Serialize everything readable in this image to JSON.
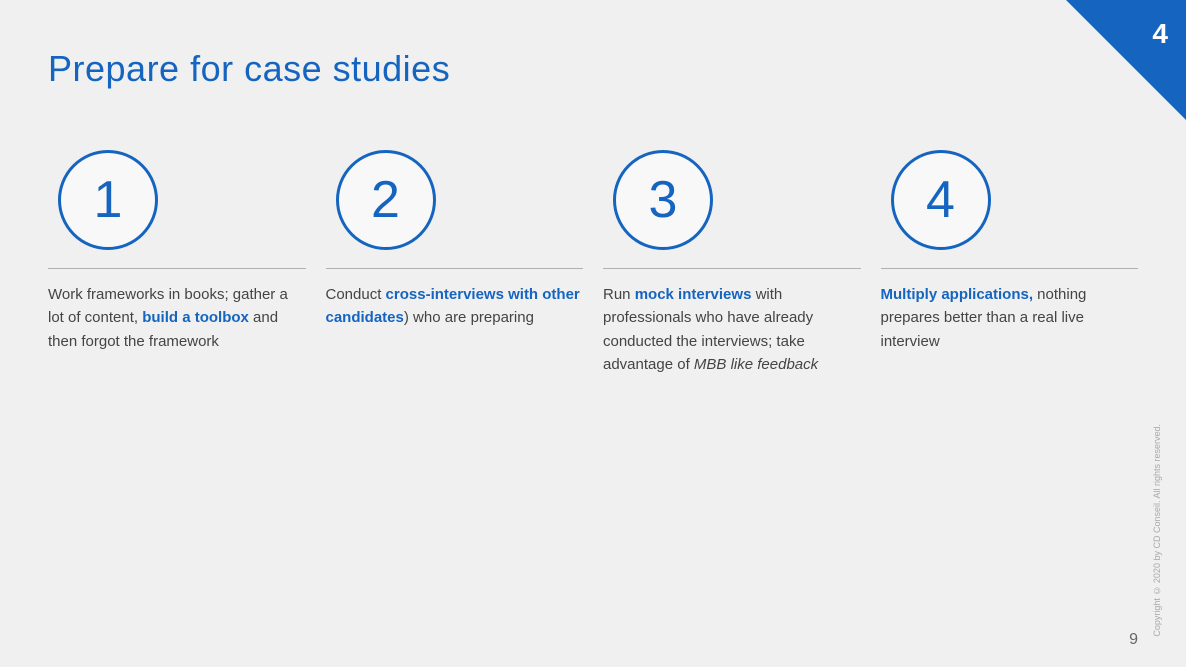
{
  "slide": {
    "title": "Prepare for case studies",
    "corner_number": "4",
    "page_number": "9",
    "copyright": "Copyright © 2020 by CD Conseil. All rights reserved."
  },
  "steps": [
    {
      "id": 1,
      "number": "1",
      "text_parts": [
        {
          "text": "Work frameworks in books; gather a lot of content, ",
          "type": "normal"
        },
        {
          "text": "build a toolbox",
          "type": "highlight"
        },
        {
          "text": " and then forgot the framework",
          "type": "normal"
        }
      ]
    },
    {
      "id": 2,
      "number": "2",
      "text_parts": [
        {
          "text": "Conduct ",
          "type": "normal"
        },
        {
          "text": "cross-interviews with other candidates",
          "type": "highlight"
        },
        {
          "text": ") who are preparing",
          "type": "normal"
        }
      ]
    },
    {
      "id": 3,
      "number": "3",
      "text_parts": [
        {
          "text": "Run ",
          "type": "normal"
        },
        {
          "text": "mock interviews",
          "type": "highlight"
        },
        {
          "text": " with professionals who have already conducted the interviews; take advantage of ",
          "type": "normal"
        },
        {
          "text": "MBB like feedback",
          "type": "italic"
        }
      ]
    },
    {
      "id": 4,
      "number": "4",
      "text_parts": [
        {
          "text": "Multiply applications,",
          "type": "highlight"
        },
        {
          "text": " nothing prepares better than a real live interview",
          "type": "normal"
        }
      ]
    }
  ]
}
